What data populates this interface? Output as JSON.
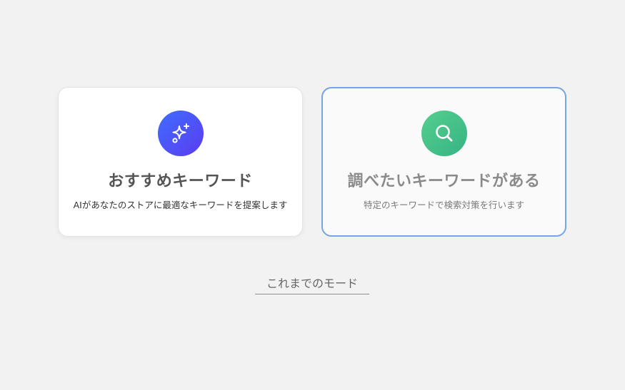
{
  "cards": [
    {
      "icon": "sparkles-icon",
      "title": "おすすめキーワード",
      "description": "AIがあなたのストアに最適なキーワードを提案します"
    },
    {
      "icon": "search-icon",
      "title": "調べたいキーワードがある",
      "description": "特定のキーワードで検索対策を行います"
    }
  ],
  "legacy_mode": {
    "label": "これまでのモード"
  },
  "colors": {
    "background": "#f2f2f2",
    "recommended_icon_gradient": [
      "#3f6dff",
      "#5b3cf0"
    ],
    "search_icon_gradient": [
      "#55cf8e",
      "#36b384"
    ],
    "selected_border": "#74a6e4"
  }
}
